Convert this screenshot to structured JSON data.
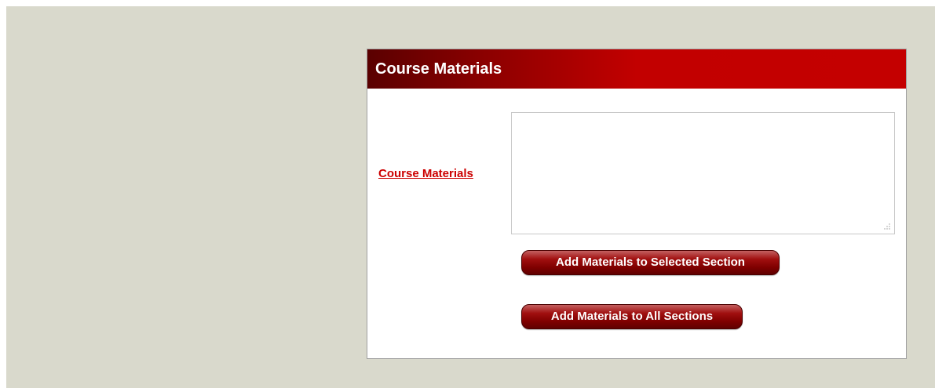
{
  "panel": {
    "title": "Course Materials"
  },
  "form": {
    "field_label": "Course Materials",
    "textarea_value": ""
  },
  "buttons": {
    "add_selected_label": "Add Materials to Selected Section",
    "add_all_label": "Add Materials to All Sections"
  },
  "colors": {
    "page_background": "#d9d9cc",
    "header_gradient_start": "#5a0000",
    "header_gradient_end": "#c40000",
    "label_color": "#cc0000",
    "button_color": "#7f0000"
  },
  "icons": {
    "resize_grip": "resize-grip-icon"
  }
}
